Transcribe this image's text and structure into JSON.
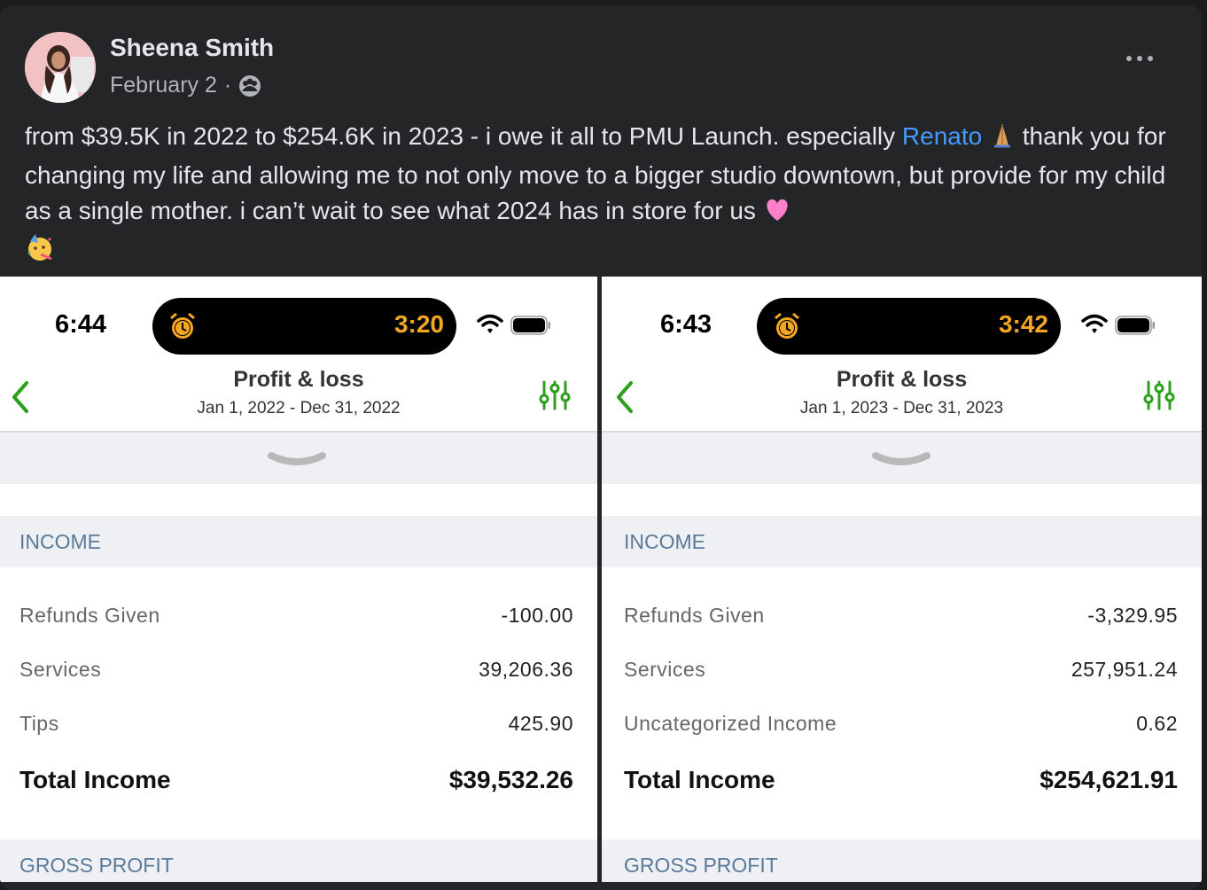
{
  "post": {
    "author": "Sheena Smith",
    "date": "February 2",
    "separator": "·",
    "text_1": "from $39.5K in 2022 to $254.6K in 2023 - i owe it all to PMU Launch. especially ",
    "mention": "Renato",
    "text_2": " thank you for changing my life and allowing me to not only move to a bigger studio downtown, but provide for my child as a single mother. i can’t wait to see what 2024 has in store for us ",
    "emojis": [
      "folded-hands",
      "pink-heart",
      "partying-face"
    ]
  },
  "screenshots": [
    {
      "status_time": "6:44",
      "island_timer": "3:20",
      "title": "Profit & loss",
      "date_range": "Jan 1, 2022 - Dec 31, 2022",
      "income_header": "INCOME",
      "rows": [
        {
          "label": "Refunds Given",
          "value": "-100.00"
        },
        {
          "label": "Services",
          "value": "39,206.36"
        },
        {
          "label": "Tips",
          "value": "425.90"
        }
      ],
      "total_label": "Total Income",
      "total_value": "$39,532.26",
      "gross_header": "GROSS PROFIT"
    },
    {
      "status_time": "6:43",
      "island_timer": "3:42",
      "title": "Profit & loss",
      "date_range": "Jan 1, 2023 - Dec 31, 2023",
      "income_header": "INCOME",
      "rows": [
        {
          "label": "Refunds Given",
          "value": "-3,329.95"
        },
        {
          "label": "Services",
          "value": "257,951.24"
        },
        {
          "label": "Uncategorized Income",
          "value": "0.62"
        }
      ],
      "total_label": "Total Income",
      "total_value": "$254,621.91",
      "gross_header": "GROSS PROFIT"
    }
  ],
  "colors": {
    "accent_green": "#2ca01c",
    "mention_blue": "#4599ff",
    "timer_orange": "#f5a623"
  }
}
